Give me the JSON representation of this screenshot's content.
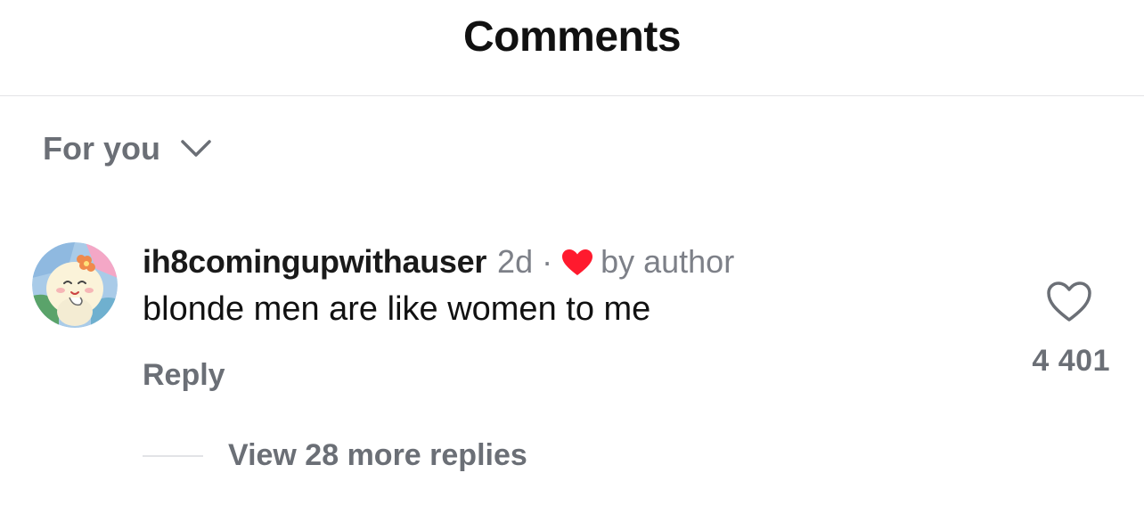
{
  "header": {
    "title": "Comments"
  },
  "sort": {
    "label": "For you",
    "icon": "chevron-down-icon"
  },
  "comment": {
    "avatar": "user-avatar",
    "username": "ih8comingupwithauser",
    "time": "2d",
    "separator": "·",
    "liked_by_author_icon": "heart-icon",
    "liked_by_author_color": "#ff1a2e",
    "by_author": "by author",
    "text": "blonde men are like women to me",
    "reply_label": "Reply",
    "like_icon": "heart-outline-icon",
    "like_count": "4 401",
    "view_replies_label": "View 28 more replies"
  }
}
